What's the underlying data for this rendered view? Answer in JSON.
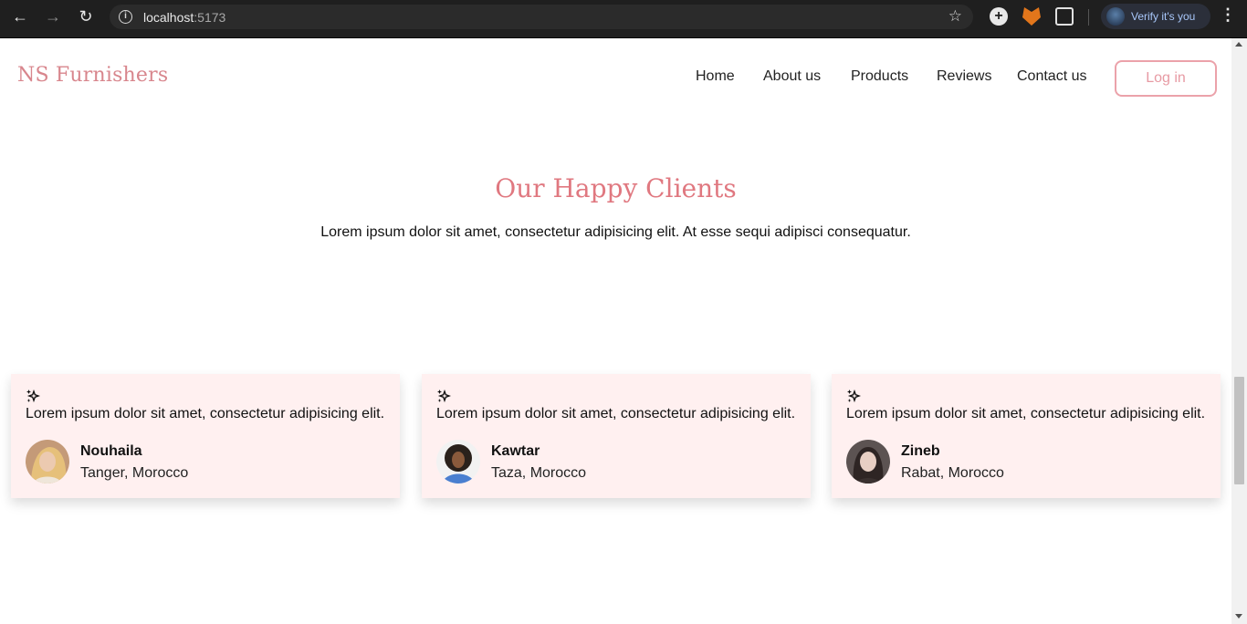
{
  "browser": {
    "url_host": "localhost",
    "url_port": ":5173",
    "profile_label": "Verify it's you",
    "icons": [
      "back-arrow-icon",
      "forward-arrow-icon",
      "reload-icon",
      "site-info-icon",
      "bookmark-star-icon",
      "extension-add-icon",
      "metamask-fox-icon",
      "extensions-puzzle-icon",
      "profile-avatar-icon",
      "kebab-menu-icon"
    ]
  },
  "header": {
    "logo": "NS Furnishers",
    "nav": [
      "Home",
      "About us",
      "Products",
      "Reviews",
      "Contact us"
    ],
    "login": "Log in"
  },
  "section": {
    "title": "Our Happy Clients",
    "subtitle": "Lorem ipsum dolor sit amet, consectetur adipisicing elit. At esse sequi adipisci consequatur."
  },
  "testimonials": [
    {
      "quote": "Lorem ipsum dolor sit amet, consectetur adipisicing elit.",
      "name": "Nouhaila",
      "location": "Tanger, Morocco"
    },
    {
      "quote": "Lorem ipsum dolor sit amet, consectetur adipisicing elit.",
      "name": "Kawtar",
      "location": "Taza, Morocco"
    },
    {
      "quote": "Lorem ipsum dolor sit amet, consectetur adipisicing elit.",
      "name": "Zineb",
      "location": "Rabat, Morocco"
    }
  ],
  "colors": {
    "brand": "#d8868d",
    "title": "#e07880",
    "card_bg": "#fff0f0",
    "login_border": "#eba2aa"
  }
}
